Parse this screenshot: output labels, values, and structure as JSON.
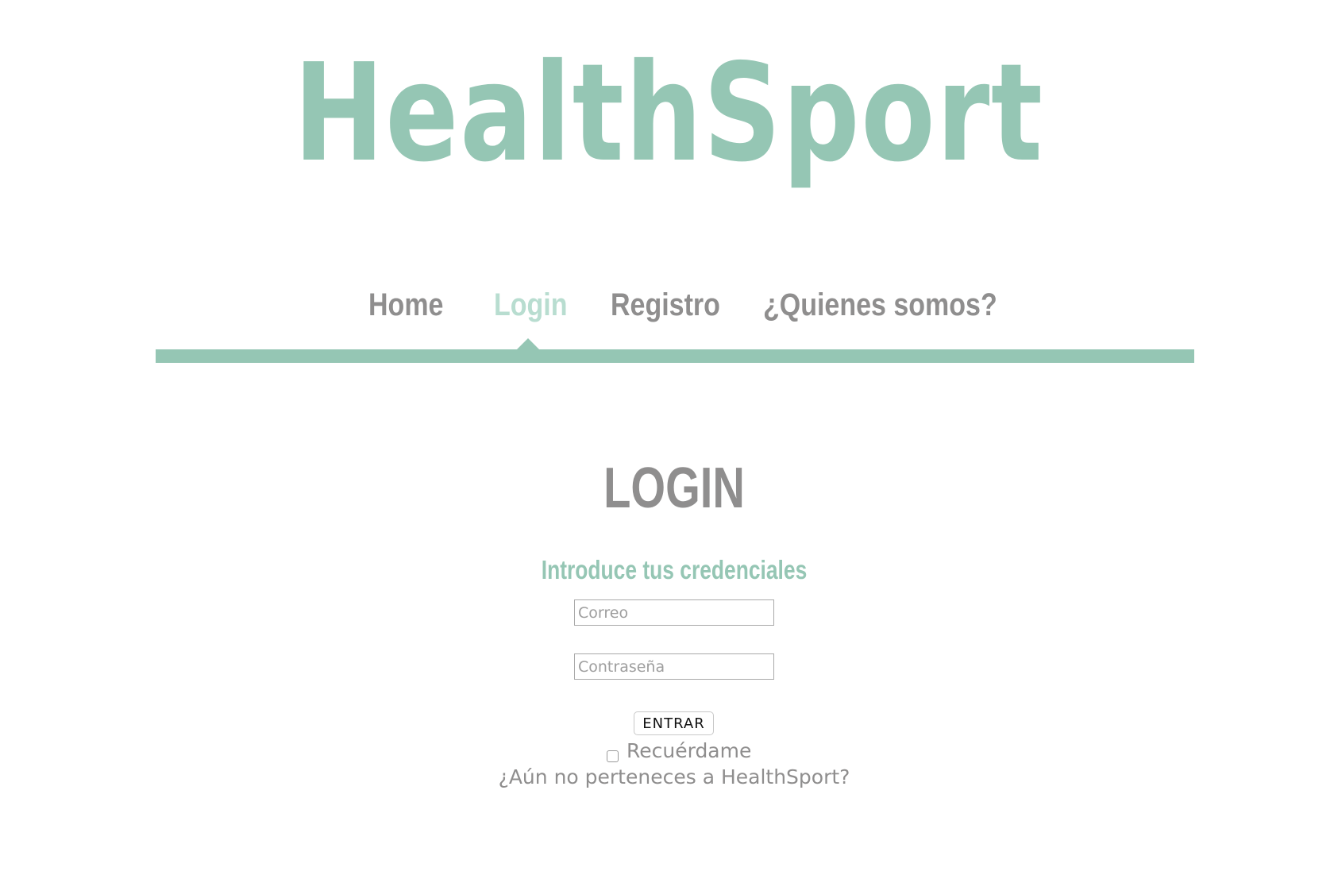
{
  "header": {
    "logo_text": "HealthSport"
  },
  "nav": {
    "items": [
      {
        "label": "Home",
        "active": false
      },
      {
        "label": "Login",
        "active": true
      },
      {
        "label": "Registro",
        "active": false
      },
      {
        "label": "¿Quienes somos?",
        "active": false
      }
    ]
  },
  "login": {
    "title": "LOGIN",
    "subtitle": "Introduce tus credenciales",
    "email_placeholder": "Correo",
    "email_value": "",
    "password_placeholder": "Contraseña",
    "password_value": "",
    "submit_label": "ENTRAR",
    "remember_label": "Recuérdame",
    "remember_checked": false,
    "register_prompt": "¿Aún no perteneces a HealthSport?"
  },
  "colors": {
    "brand_green": "#95c6b4",
    "active_nav": "#b8ddd0",
    "text_gray": "#8f8e8e"
  }
}
